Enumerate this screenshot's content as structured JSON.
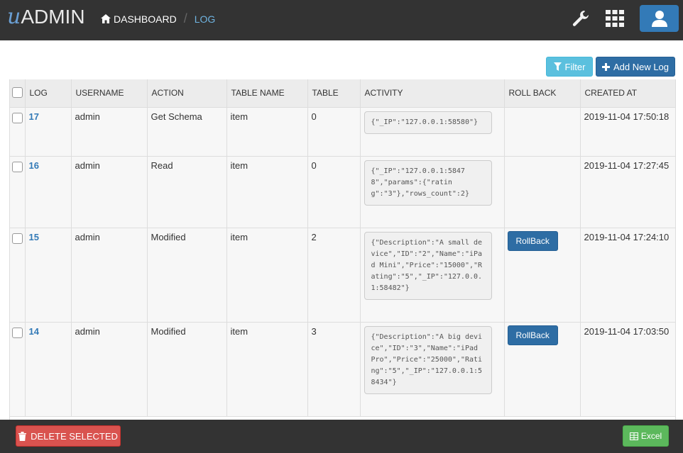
{
  "header": {
    "logo_u": "u",
    "logo_admin": "ADMIN",
    "breadcrumb": {
      "home": "DASHBOARD",
      "current": "LOG"
    }
  },
  "actions": {
    "filter": "Filter",
    "add_new": "Add New Log"
  },
  "table": {
    "columns": [
      "LOG",
      "USERNAME",
      "ACTION",
      "TABLE NAME",
      "TABLE",
      "ACTIVITY",
      "ROLL BACK",
      "CREATED AT"
    ],
    "rows": [
      {
        "log": "17",
        "username": "admin",
        "action": "Get Schema",
        "table_name": "item",
        "table": "0",
        "activity": "{\"_IP\":\"127.0.0.1:58580\"}",
        "rollback": "",
        "created_at": "2019-11-04 17:50:18"
      },
      {
        "log": "16",
        "username": "admin",
        "action": "Read",
        "table_name": "item",
        "table": "0",
        "activity": "{\"_IP\":\"127.0.0.1:58478\",\"params\":{\"rating\":\"3\"},\"rows_count\":2}",
        "rollback": "",
        "created_at": "2019-11-04 17:27:45"
      },
      {
        "log": "15",
        "username": "admin",
        "action": "Modified",
        "table_name": "item",
        "table": "2",
        "activity": "{\"Description\":\"A small device\",\"ID\":\"2\",\"Name\":\"iPad Mini\",\"Price\":\"15000\",\"Rating\":\"5\",\"_IP\":\"127.0.0.1:58482\"}",
        "rollback": "RollBack",
        "created_at": "2019-11-04 17:24:10"
      },
      {
        "log": "14",
        "username": "admin",
        "action": "Modified",
        "table_name": "item",
        "table": "3",
        "activity": "{\"Description\":\"A big device\",\"ID\":\"3\",\"Name\":\"iPad Pro\",\"Price\":\"25000\",\"Rating\":\"5\",\"_IP\":\"127.0.0.1:58434\"}",
        "rollback": "RollBack",
        "created_at": "2019-11-04 17:03:50"
      }
    ]
  },
  "footer": {
    "delete_selected": "DELETE SELECTED",
    "excel": "Excel"
  },
  "colors": {
    "topbar": "#333333",
    "primary": "#337ab7",
    "info": "#5bc0de",
    "danger": "#d9534f",
    "success": "#5cb85c"
  }
}
